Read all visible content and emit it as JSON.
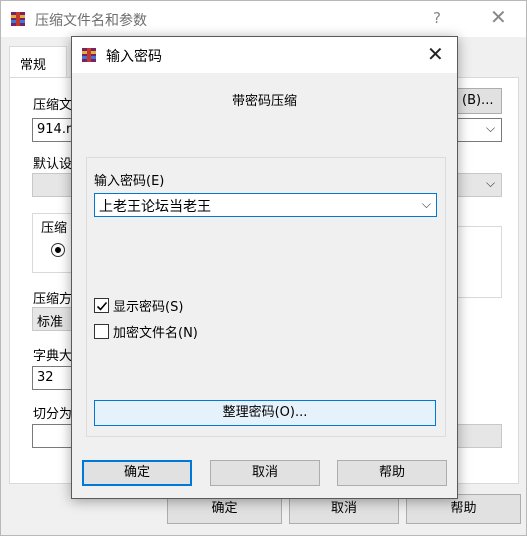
{
  "background_window": {
    "title": "压缩文件名和参数",
    "help_glyph": "?",
    "close_glyph": "✕",
    "tab_general": "常规",
    "archive_name_label": "压缩文",
    "archive_name_value": "914.ra",
    "browse_button": "(B)...",
    "default_profile_label": "默认设",
    "compress_format_group": "压缩",
    "compress_method_label": "压缩方",
    "compress_method_value": "标准",
    "dictionary_label": "字典大",
    "dictionary_value": "32",
    "split_label": "切分为",
    "ok_button": "确定",
    "cancel_button": "取消",
    "help_button": "帮助"
  },
  "dialog": {
    "title": "输入密码",
    "close_glyph": "✕",
    "subtitle": "带密码压缩",
    "password_label": "输入密码(E)",
    "password_value": "上老王论坛当老王",
    "show_password_label": "显示密码(S)",
    "show_password_checked": true,
    "encrypt_filenames_label": "加密文件名(N)",
    "encrypt_filenames_checked": false,
    "organize_button": "整理密码(O)...",
    "ok_button": "确定",
    "cancel_button": "取消",
    "help_button": "帮助"
  },
  "colors": {
    "accent": "#0078d7",
    "button_face": "#e1e1e1",
    "window_bg": "#f0f0f0"
  }
}
